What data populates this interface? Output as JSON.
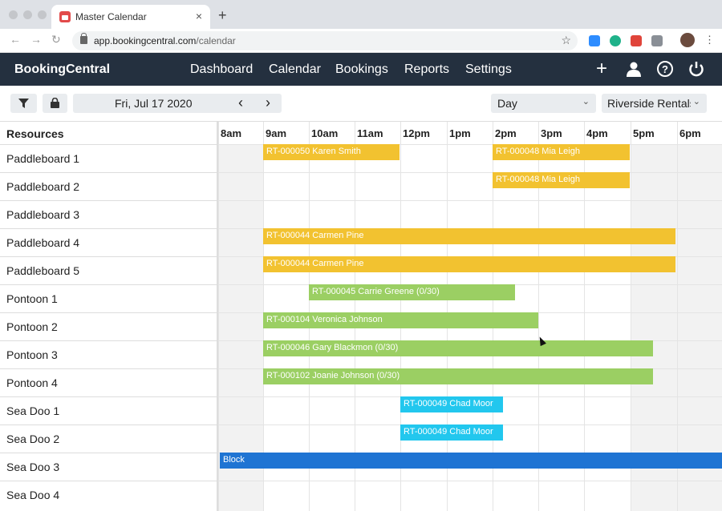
{
  "browser": {
    "tab_title": "Master Calendar",
    "tab_close": "×",
    "new_tab": "+",
    "url_host": "app.bookingcentral.com",
    "url_path": "/calendar",
    "star": "☆",
    "menu": "⋮"
  },
  "app": {
    "brand": "BookingCentral",
    "nav": [
      "Dashboard",
      "Calendar",
      "Bookings",
      "Reports",
      "Settings"
    ],
    "icons": [
      "plus-icon",
      "user-icon",
      "help-icon",
      "power-icon"
    ]
  },
  "controls": {
    "date": "Fri, Jul 17 2020",
    "prev": "‹",
    "next": "›",
    "view": "Day",
    "location": "Riverside Rentals"
  },
  "calendar": {
    "resources_header": "Resources",
    "times": [
      "8am",
      "9am",
      "10am",
      "11am",
      "12pm",
      "1pm",
      "2pm",
      "3pm",
      "4pm",
      "5pm",
      "6pm"
    ],
    "resources": [
      "Paddleboard 1",
      "Paddleboard 2",
      "Paddleboard 3",
      "Paddleboard 4",
      "Paddleboard 5",
      "Pontoon 1",
      "Pontoon 2",
      "Pontoon 3",
      "Pontoon 4",
      "Sea Doo 1",
      "Sea Doo 2",
      "Sea Doo 3",
      "Sea Doo 4"
    ],
    "events": [
      {
        "label": "RT-000050 Karen Smith",
        "color": "#f2c230"
      },
      {
        "label": "RT-000048 Mia Leigh",
        "color": "#f2c230"
      },
      {
        "label": "RT-000048 Mia Leigh",
        "color": "#f2c230"
      },
      {
        "label": "RT-000044 Carmen Pine",
        "color": "#f2c230"
      },
      {
        "label": "RT-000044 Carmen Pine",
        "color": "#f2c230"
      },
      {
        "label": "RT-000045 Carrie Greene (0/30)",
        "color": "#9bcf63"
      },
      {
        "label": "RT-000104 Veronica Johnson",
        "color": "#9bcf63"
      },
      {
        "label": "RT-000046 Gary Blackmon (0/30)",
        "color": "#9bcf63"
      },
      {
        "label": "RT-000102 Joanie Johnson (0/30)",
        "color": "#9bcf63"
      },
      {
        "label": "RT-000049 Chad Moor",
        "color": "#22c7ee"
      },
      {
        "label": "RT-000049 Chad Moor",
        "color": "#22c7ee"
      },
      {
        "label": "Block",
        "color": "#1f74d3"
      }
    ]
  }
}
